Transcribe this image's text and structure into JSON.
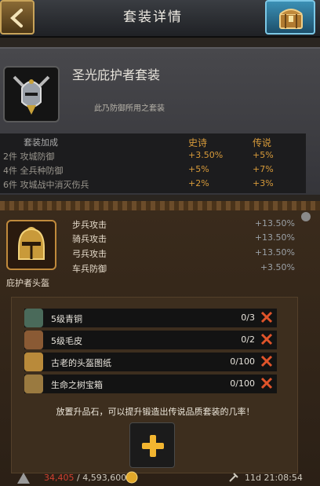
{
  "header": {
    "title": "套装详情",
    "back_icon": "back-arrow-icon",
    "chest_icon": "treasure-chest-icon"
  },
  "set": {
    "name": "圣光庇护者套装",
    "description": "此乃防御所用之套装",
    "emblem_icon": "knight-helmet-emblem-icon",
    "bonus_header": {
      "name": "套装加成",
      "epic": "史诗",
      "legendary": "传说"
    },
    "bonuses": [
      {
        "name": "2件 攻城防御",
        "epic": "+3.50%",
        "legendary": "+5%"
      },
      {
        "name": "4件 全兵种防御",
        "epic": "+5%",
        "legendary": "+7%"
      },
      {
        "name": "6件 攻城战中消灭伤兵",
        "epic": "+2%",
        "legendary": "+3%"
      }
    ]
  },
  "piece": {
    "name": "庇护者头盔",
    "icon": "golden-helmet-icon",
    "stats": [
      {
        "label": "步兵攻击",
        "value": "+13.50%"
      },
      {
        "label": "骑兵攻击",
        "value": "+13.50%"
      },
      {
        "label": "弓兵攻击",
        "value": "+13.50%"
      },
      {
        "label": "车兵防御",
        "value": "+3.50%"
      }
    ]
  },
  "materials": [
    {
      "name": "5级青铜",
      "count": "0/3",
      "icon": "bronze-ore-icon",
      "color": "#4a6a5a"
    },
    {
      "name": "5级毛皮",
      "count": "0/2",
      "icon": "fur-pelt-icon",
      "color": "#8a5a34"
    },
    {
      "name": "古老的头盔图纸",
      "count": "0/100",
      "icon": "blueprint-scroll-icon",
      "color": "#b98a3a"
    },
    {
      "name": "生命之树宝箱",
      "count": "0/100",
      "icon": "mystery-chest-icon",
      "color": "#9a7a40"
    }
  ],
  "hint": "放置升品石，可以提升锻造出传说品质套装的几率！",
  "add_icon": "plus-icon",
  "footer": {
    "resource_current": "34,405",
    "resource_total": "4,593,600",
    "timer": "11d 21:08:54"
  },
  "colors": {
    "accent_gold": "#d89b3a",
    "missing_red": "#e0542a"
  }
}
